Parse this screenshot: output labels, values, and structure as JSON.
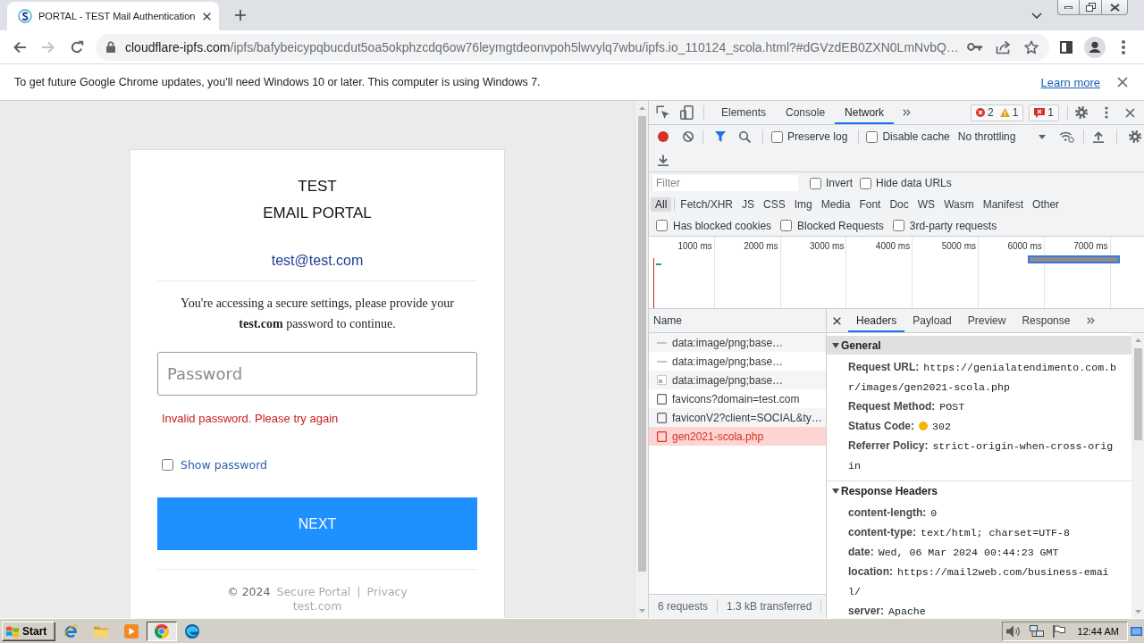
{
  "browser": {
    "tabs": [
      {
        "title": "PORTAL - TEST Mail Authentication",
        "selected": true
      }
    ],
    "address": {
      "host": "cloudflare-ipfs.com",
      "path": "/ipfs/bafybeicypqbucdut5oa5okphzcdq6ow76leymgtdeonvpoh5lwvylq7wbu/ipfs.io_110124_scola.html?#dGVzdEB0ZXN0LmNvbQ…"
    }
  },
  "infobar": {
    "message": "To get future Google Chrome updates, you'll need Windows 10 or later. This computer is using Windows 7.",
    "link": "Learn more"
  },
  "login": {
    "title_lines": [
      "TEST",
      "EMAIL PORTAL"
    ],
    "email": "test@test.com",
    "prompt": "You're accessing a secure settings, please provide your **test.com** password to continue.",
    "password": {
      "placeholder": "Password"
    },
    "error": "Invalid password. Please try again",
    "show_password": {
      "label": "Show password",
      "checked": false
    },
    "submit": "NEXT",
    "footer": {
      "copyright": "© 2024",
      "links": [
        "Secure Portal",
        "Privacy"
      ],
      "separator": "|",
      "domain": "test.com"
    }
  },
  "devtools": {
    "tabs": [
      {
        "label": "Elements",
        "selected": false
      },
      {
        "label": "Console",
        "selected": false
      },
      {
        "label": "Network",
        "selected": true
      }
    ],
    "counters": {
      "errors": "2",
      "warnings": "1",
      "issues": "1"
    },
    "toolbar": {
      "recording": true,
      "checkboxes": [
        {
          "label": "Preserve log",
          "checked": false
        },
        {
          "label": "Disable cache",
          "checked": false
        }
      ],
      "throttling": "No throttling"
    },
    "filter": {
      "placeholder": "Filter",
      "checkboxes": [
        {
          "label": "Invert",
          "checked": false
        },
        {
          "label": "Hide data URLs",
          "checked": false
        }
      ],
      "types": [
        {
          "label": "All",
          "selected": true
        },
        {
          "label": "Fetch/XHR",
          "selected": false
        },
        {
          "label": "JS",
          "selected": false
        },
        {
          "label": "CSS",
          "selected": false
        },
        {
          "label": "Img",
          "selected": false
        },
        {
          "label": "Media",
          "selected": false
        },
        {
          "label": "Font",
          "selected": false
        },
        {
          "label": "Doc",
          "selected": false
        },
        {
          "label": "WS",
          "selected": false
        },
        {
          "label": "Wasm",
          "selected": false
        },
        {
          "label": "Manifest",
          "selected": false
        },
        {
          "label": "Other",
          "selected": false
        }
      ],
      "more": [
        {
          "label": "Has blocked cookies",
          "checked": false
        },
        {
          "label": "Blocked Requests",
          "checked": false
        },
        {
          "label": "3rd-party requests",
          "checked": false
        }
      ]
    },
    "overview": {
      "ticks": [
        "1000 ms",
        "2000 ms",
        "3000 ms",
        "4000 ms",
        "5000 ms",
        "6000 ms",
        "7000 ms"
      ]
    },
    "requests": {
      "column": "Name",
      "rows": [
        {
          "name": "data:image/png;base…",
          "kind": "line",
          "selected": false,
          "failed": false
        },
        {
          "name": "data:image/png;base…",
          "kind": "line",
          "selected": false,
          "failed": false
        },
        {
          "name": "data:image/png;base…",
          "kind": "thumb",
          "selected": false,
          "failed": false
        },
        {
          "name": "favicons?domain=test.com",
          "kind": "file",
          "selected": false,
          "failed": false
        },
        {
          "name": "faviconV2?client=SOCIAL&ty…",
          "kind": "file",
          "selected": false,
          "failed": false
        },
        {
          "name": "gen2021-scola.php",
          "kind": "file",
          "selected": true,
          "failed": true
        }
      ]
    },
    "summary": [
      "6 requests",
      "1.3 kB transferred"
    ],
    "details": {
      "tabs": [
        {
          "label": "Headers",
          "selected": true
        },
        {
          "label": "Payload",
          "selected": false
        },
        {
          "label": "Preview",
          "selected": false
        },
        {
          "label": "Response",
          "selected": false
        }
      ],
      "sections": [
        {
          "title": "General",
          "expanded": true,
          "selected": true,
          "rows": [
            {
              "key": "Request URL:",
              "value": "https://genialatendimento.com.br/images/gen2021-scola.php",
              "kind": "text"
            },
            {
              "key": "Request Method:",
              "value": "POST",
              "kind": "text"
            },
            {
              "key": "Status Code:",
              "value": "302",
              "kind": "status"
            },
            {
              "key": "Referrer Policy:",
              "value": "strict-origin-when-cross-origin",
              "kind": "text"
            }
          ]
        },
        {
          "title": "Response Headers",
          "expanded": true,
          "selected": false,
          "rows": [
            {
              "key": "content-length:",
              "value": "0",
              "kind": "text"
            },
            {
              "key": "content-type:",
              "value": "text/html; charset=UTF-8",
              "kind": "text"
            },
            {
              "key": "date:",
              "value": "Wed, 06 Mar 2024 00:44:23 GMT",
              "kind": "text"
            },
            {
              "key": "location:",
              "value": "https://mail2web.com/business-email/",
              "kind": "text"
            },
            {
              "key": "server:",
              "value": "Apache",
              "kind": "text"
            }
          ]
        }
      ]
    }
  },
  "taskbar": {
    "start": "Start",
    "apps": [
      {
        "active": false
      },
      {
        "active": false
      },
      {
        "active": false
      },
      {
        "active": true
      },
      {
        "active": false
      }
    ],
    "clock": "12:44 AM"
  }
}
